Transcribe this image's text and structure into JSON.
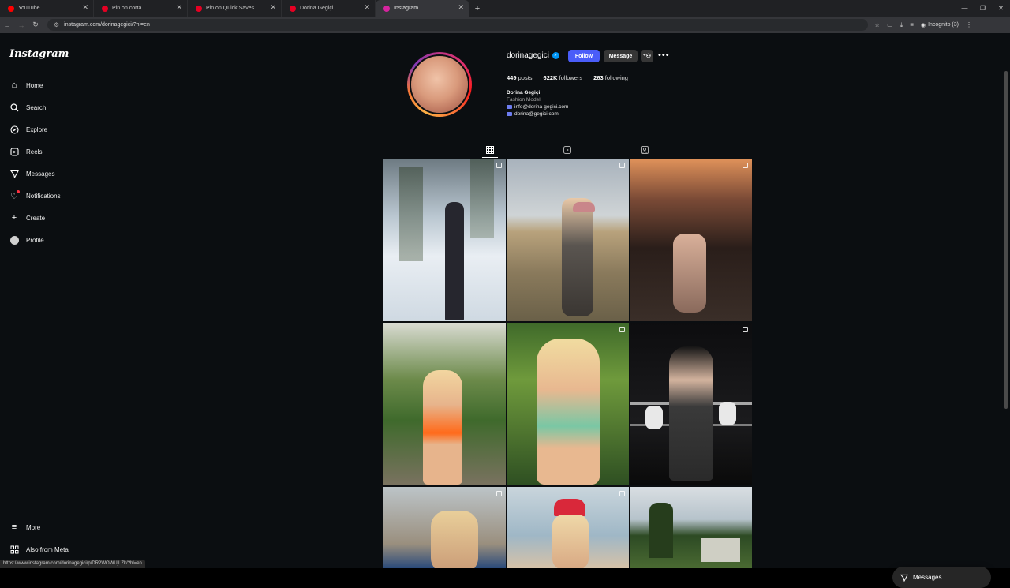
{
  "browser": {
    "tabs": [
      {
        "label": "YouTube",
        "color": "#ff0000"
      },
      {
        "label": "Pin on corta",
        "color": "#e60023"
      },
      {
        "label": "Pin on Quick Saves",
        "color": "#e60023"
      },
      {
        "label": "Dorina Gegiçi",
        "color": "#e60023"
      },
      {
        "label": "Instagram",
        "color": "#d6249f"
      }
    ],
    "url": "instagram.com/dorinagegici/?hl=en",
    "incognito": "Incognito (3)",
    "status_url": "https://www.instagram.com/dorinagegici/p/DR2WOWUjLZk/?hl=en"
  },
  "sidebar": {
    "logo": "Instagram",
    "items": [
      {
        "label": "Home",
        "icon": "home-icon"
      },
      {
        "label": "Search",
        "icon": "search-icon"
      },
      {
        "label": "Explore",
        "icon": "explore-icon"
      },
      {
        "label": "Reels",
        "icon": "reels-icon"
      },
      {
        "label": "Messages",
        "icon": "messages-icon"
      },
      {
        "label": "Notifications",
        "icon": "heart-icon"
      },
      {
        "label": "Create",
        "icon": "plus-icon"
      },
      {
        "label": "Profile",
        "icon": "avatar-icon"
      }
    ],
    "more": "More",
    "meta": "Also from Meta"
  },
  "profile": {
    "username": "dorinagegici",
    "follow": "Follow",
    "message": "Message",
    "stats": {
      "posts": "449",
      "posts_label": "posts",
      "followers": "622K",
      "followers_label": "followers",
      "following": "263",
      "following_label": "following"
    },
    "bio": {
      "name": "Dorina Gegiçi",
      "category": "Fashion Model",
      "email1": "info@dorina-gegici.com",
      "email2": "dorina@gegici.com"
    }
  },
  "messages_pill": "Messages",
  "colors": {
    "follow": "#4a5df9",
    "verified": "#0095f6",
    "notification_dot": "#ff3040"
  }
}
